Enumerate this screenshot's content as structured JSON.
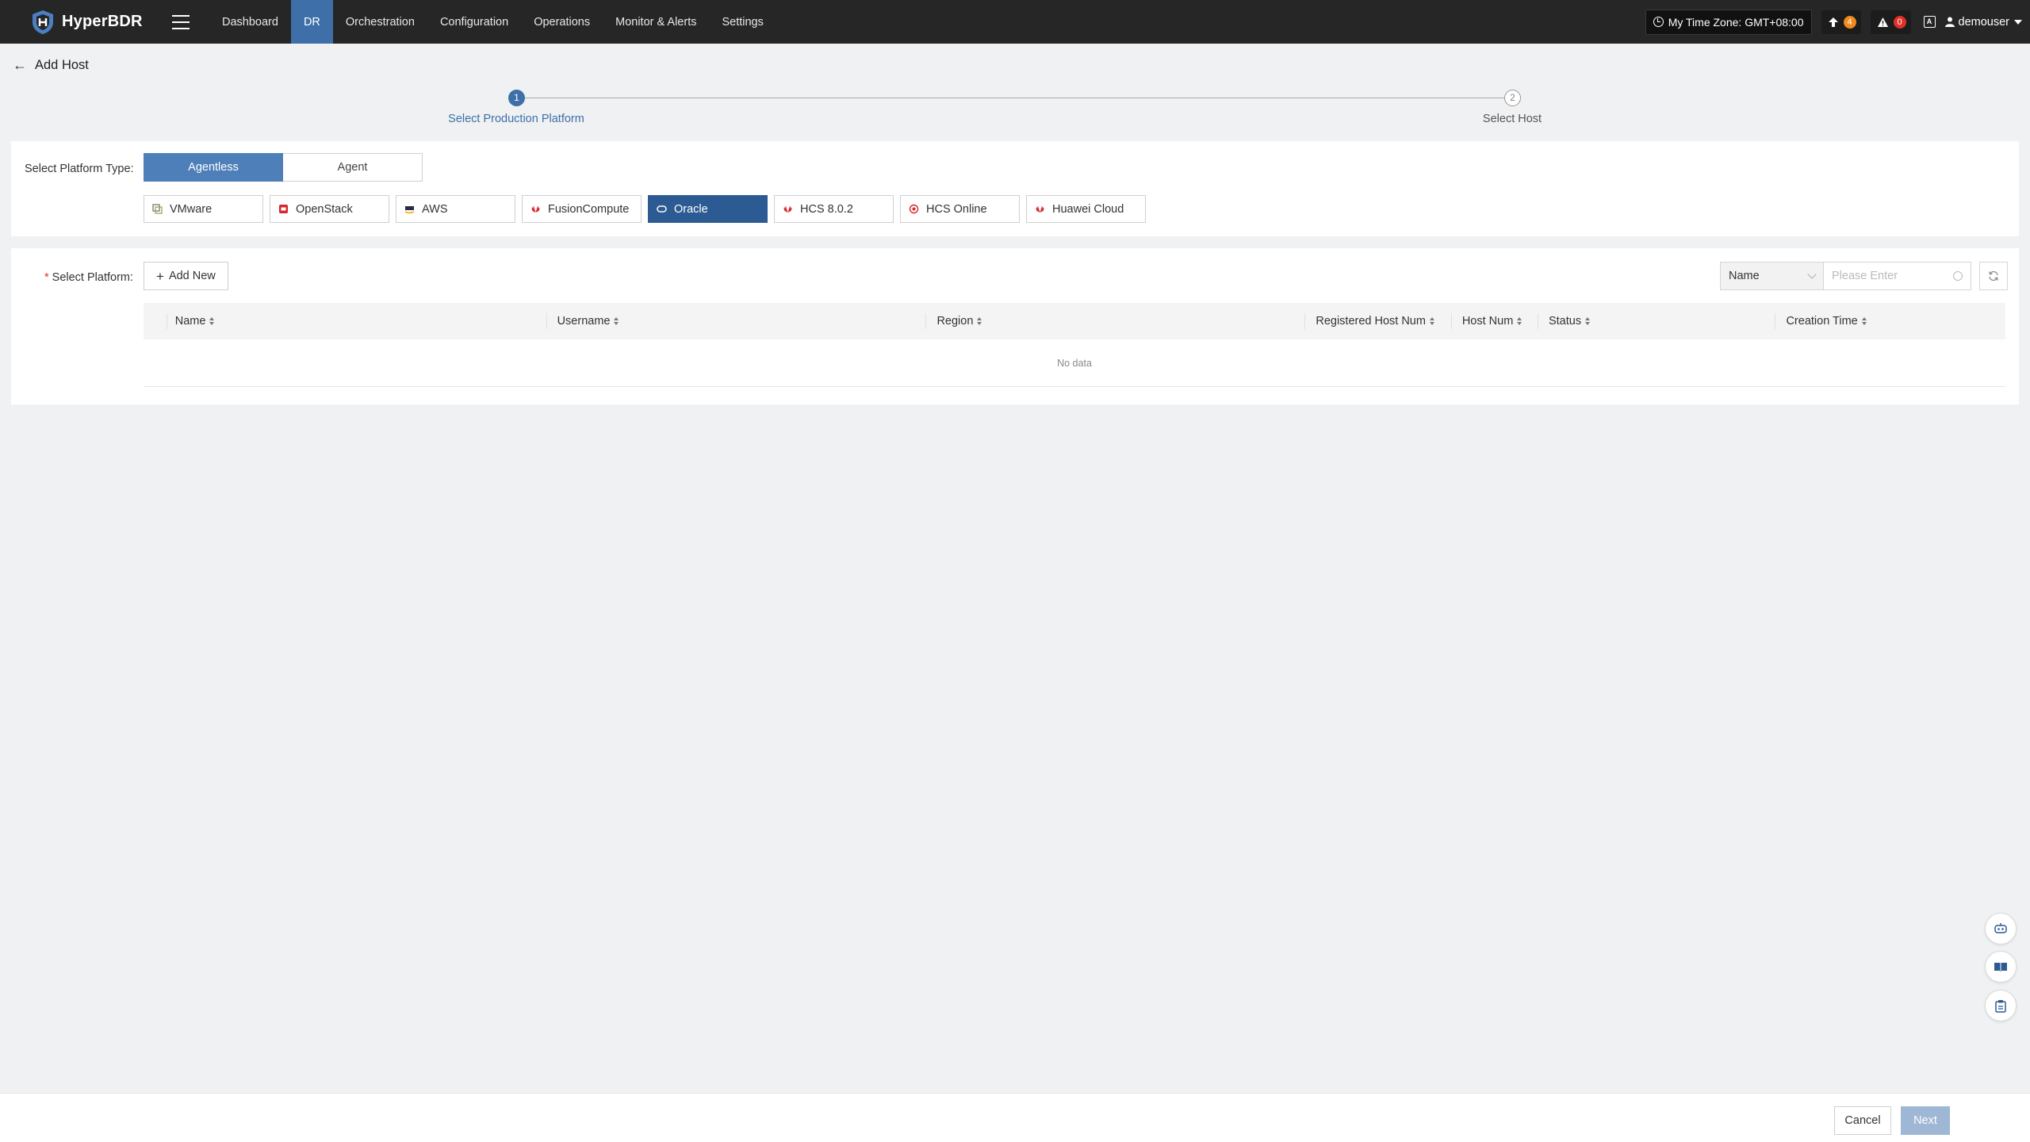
{
  "app": {
    "name": "HyperBDR"
  },
  "nav": {
    "items": [
      {
        "label": "Dashboard",
        "active": false
      },
      {
        "label": "DR",
        "active": true
      },
      {
        "label": "Orchestration",
        "active": false
      },
      {
        "label": "Configuration",
        "active": false
      },
      {
        "label": "Operations",
        "active": false
      },
      {
        "label": "Monitor & Alerts",
        "active": false
      },
      {
        "label": "Settings",
        "active": false
      }
    ]
  },
  "topbar": {
    "timezone": "My Time Zone: GMT+08:00",
    "upgrade_count": "4",
    "alert_count": "0",
    "username": "demouser"
  },
  "header": {
    "title": "Add Host"
  },
  "steps": [
    {
      "number": "1",
      "label": "Select Production Platform",
      "active": true
    },
    {
      "number": "2",
      "label": "Select Host",
      "active": false
    }
  ],
  "platform_type": {
    "label": "Select Platform Type:",
    "options": [
      "Agentless",
      "Agent"
    ],
    "selected": "Agentless"
  },
  "platforms": {
    "items": [
      "VMware",
      "OpenStack",
      "AWS",
      "FusionCompute",
      "Oracle",
      "HCS 8.0.2",
      "HCS Online",
      "Huawei Cloud"
    ],
    "selected": "Oracle"
  },
  "select_platform": {
    "required_mark": "*",
    "label": "Select Platform:",
    "add_new_label": "Add New",
    "filter_field": "Name",
    "search_placeholder": "Please Enter"
  },
  "table": {
    "columns": [
      "Name",
      "Username",
      "Region",
      "Registered Host Num",
      "Host Num",
      "Status",
      "Creation Time"
    ],
    "rows": [],
    "empty_text": "No data"
  },
  "footer": {
    "cancel_label": "Cancel",
    "next_label": "Next"
  },
  "colors": {
    "topbar_bg": "#262626",
    "accent": "#3e6fa8",
    "selected_platform": "#2c5a92",
    "next_disabled": "#9eb7d4",
    "alert_red": "#e0302a",
    "upgrade_orange": "#f08a1d"
  }
}
